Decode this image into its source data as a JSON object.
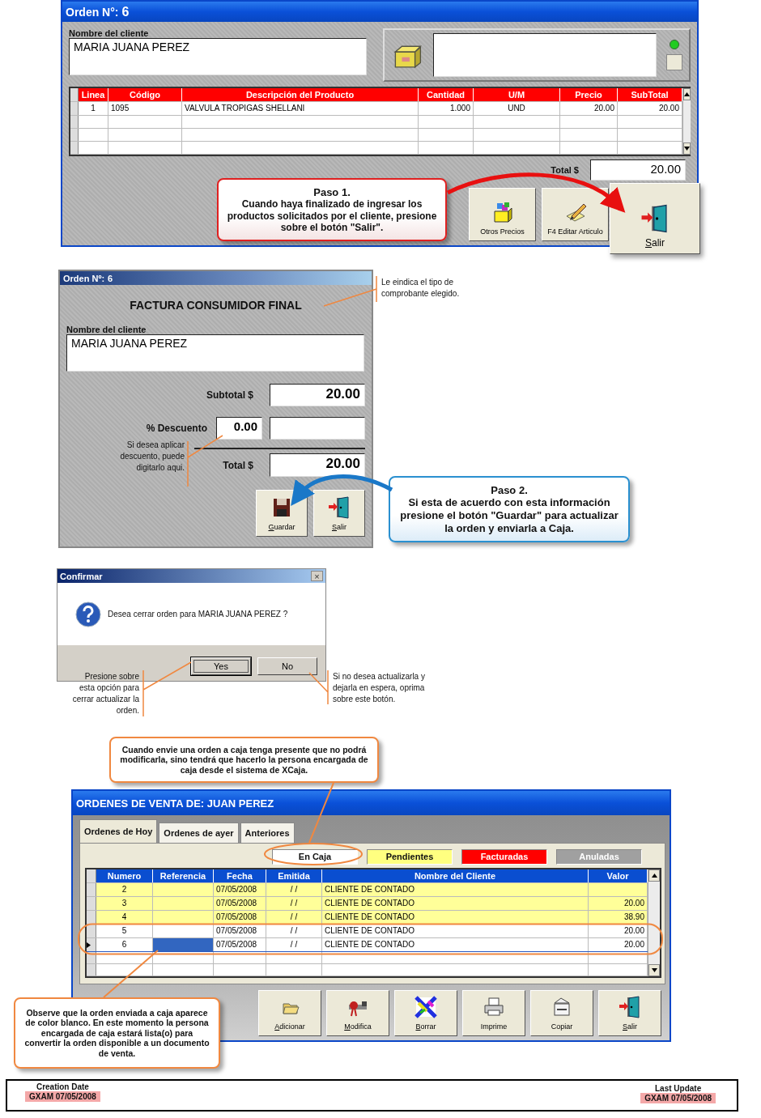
{
  "order_window": {
    "title_label": "Orden N°:",
    "title_number": "6",
    "client_label": "Nombre del cliente",
    "client_name": "MARIA JUANA PEREZ",
    "status_on": true,
    "table": {
      "columns": [
        "Linea",
        "Código",
        "Descripción del Producto",
        "Cantidad",
        "U/M",
        "Precio",
        "SubTotal"
      ],
      "rows": [
        [
          "1",
          "1095",
          "VALVULA TROPIGAS SHELLANI",
          "1.000",
          "UND",
          "20.00",
          "20.00"
        ]
      ]
    },
    "total_label": "Total $",
    "total": "20.00",
    "buttons": [
      {
        "label": "Otros Precios",
        "underlined": false,
        "highlighted": false
      },
      {
        "label": "F4 Editar Articulo",
        "underlined": false,
        "highlighted": false
      },
      {
        "label": "Salir",
        "underlined": true,
        "highlighted": true
      }
    ],
    "callout": {
      "title": "Paso 1.",
      "text": "Cuando haya finalizado de ingresar los productos solicitados por el cliente, presione sobre el botón \"Salir\"."
    }
  },
  "invoice_window": {
    "title_label": "Orden Nº:",
    "title_number": "6",
    "heading": "FACTURA CONSUMIDOR FINAL",
    "client_label": "Nombre del cliente",
    "client_name": "MARIA JUANA PEREZ",
    "subtotal_label": "Subtotal $",
    "subtotal": "20.00",
    "discount_label": "% Descuento",
    "discount": "0.00",
    "total_label": "Total $",
    "total": "20.00",
    "buttons": [
      {
        "label": "Guardar",
        "underlined": true
      },
      {
        "label": "Salir",
        "underlined": true
      }
    ],
    "note_type": "Le eindica el tipo de comprobante elegido.",
    "note_discount": "Si desea aplicar descuento, puede digitarlo aqui.",
    "callout": {
      "title": "Paso 2.",
      "text": "Si esta de acuerdo con esta información presione el botón \"Guardar\" para actualizar la orden y enviarla a Caja."
    }
  },
  "confirm_dialog": {
    "title": "Confirmar",
    "close": "×",
    "message": "Desea cerrar orden para  MARIA JUANA PEREZ ?",
    "buttons": [
      {
        "label": "Yes",
        "focused": true
      },
      {
        "label": "No",
        "focused": false
      }
    ],
    "note_yes": "Presione sobre esta opción para cerrar actualizar la orden.",
    "note_no": "Si no desea actualizarla y dejarla en espera, oprima sobre este botón."
  },
  "caja_note": "Cuando envie una orden a caja tenga presente que no podrá modificarla, sino tendrá que hacerlo la persona encargada de caja desde el sistema de XCaja.",
  "orders_window": {
    "title": "ORDENES DE VENTA DE: JUAN PEREZ",
    "tabs": [
      {
        "label": "Ordenes de Hoy",
        "selected": true
      },
      {
        "label": "Ordenes de ayer",
        "selected": false
      },
      {
        "label": "Anteriores",
        "selected": false
      }
    ],
    "legend": [
      {
        "label": "En Caja",
        "color": "#ffffff"
      },
      {
        "label": "Pendientes",
        "color": "#ffff80"
      },
      {
        "label": "Facturadas",
        "color": "#ff0000"
      },
      {
        "label": "Anuladas",
        "color": "#a0a0a0"
      }
    ],
    "columns": [
      "Numero",
      "Referencia",
      "Fecha",
      "Emitida",
      "Nombre del Cliente",
      "Valor"
    ],
    "rows": [
      {
        "numero": "2",
        "fecha": "07/05/2008",
        "emitida": "/ /",
        "cliente": "CLIENTE DE CONTADO",
        "color": "#ffff99",
        "selected": false
      },
      {
        "numero": "3",
        "fecha": "07/05/2008",
        "emitida": "/ /",
        "cliente": "CLIENTE DE CONTADO",
        "valor": "20.00",
        "color": "#ffff99",
        "selected": false
      },
      {
        "numero": "4",
        "fecha": "07/05/2008",
        "emitida": "/ /",
        "cliente": "CLIENTE DE CONTADO",
        "valor": "38.90",
        "color": "#ffff99",
        "selected": false
      },
      {
        "numero": "5",
        "fecha": "07/05/2008",
        "emitida": "/ /",
        "cliente": "CLIENTE DE CONTADO",
        "valor": "20.00",
        "color": "#ffffff",
        "selected": false
      },
      {
        "numero": "6",
        "fecha": "07/05/2008",
        "emitida": "/ /",
        "cliente": "CLIENTE DE CONTADO",
        "valor": "20.00",
        "color": "#ffffff",
        "selected": true
      }
    ],
    "buttons": [
      {
        "label": "Adicionar",
        "underlined": true
      },
      {
        "label": "Modifica",
        "underlined": true
      },
      {
        "label": "Borrar",
        "underlined": true
      },
      {
        "label": "Imprime",
        "underlined": false
      },
      {
        "label": "Copiar",
        "underlined": false
      },
      {
        "label": "Salir",
        "underlined": true
      }
    ],
    "callout": "Observe que la orden enviada a caja aparece de color blanco. En este momento la persona encargada de caja estará lista(o) para convertir la orden disponible a un documento de venta."
  },
  "footer": {
    "created_label": "Creation Date",
    "created": "GXAM 07/05/2008",
    "updated_label": "Last Update",
    "updated": "GXAM 07/05/2008"
  }
}
